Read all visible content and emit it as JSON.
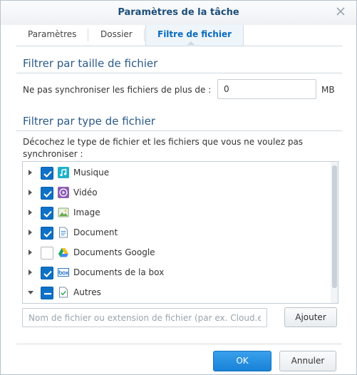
{
  "dialog": {
    "title": "Paramètres de la tâche"
  },
  "tabs": [
    {
      "label": "Paramètres"
    },
    {
      "label": "Dossier"
    },
    {
      "label": "Filtre de fichier",
      "active": true
    }
  ],
  "size_filter": {
    "title": "Filtrer par taille de fichier",
    "label": "Ne pas synchroniser les fichiers de plus de :",
    "value": "0",
    "unit": "MB"
  },
  "type_filter": {
    "title": "Filtrer par type de fichier",
    "description_line1": "Décochez le type de fichier et les fichiers que vous ne voulez pas",
    "description_line2": "synchroniser :",
    "items": [
      {
        "label": "Musique",
        "state": "checked",
        "expanded": false,
        "icon": "music-icon"
      },
      {
        "label": "Vidéo",
        "state": "checked",
        "expanded": false,
        "icon": "video-icon"
      },
      {
        "label": "Image",
        "state": "checked",
        "expanded": false,
        "icon": "image-icon"
      },
      {
        "label": "Document",
        "state": "checked",
        "expanded": false,
        "icon": "document-icon"
      },
      {
        "label": "Documents Google",
        "state": "unchecked",
        "expanded": false,
        "icon": "google-drive-icon"
      },
      {
        "label": "Documents de la box",
        "state": "checked",
        "expanded": false,
        "icon": "box-icon"
      },
      {
        "label": "Autres",
        "state": "partial",
        "expanded": true,
        "icon": "other-files-icon"
      }
    ]
  },
  "add_filter": {
    "placeholder": "Nom de fichier ou extension de fichier (par ex. Cloud.e",
    "button_label": "Ajouter"
  },
  "footer": {
    "ok_label": "OK",
    "cancel_label": "Annuler"
  },
  "colors": {
    "accent": "#0e71c8",
    "title": "#1e4f7b",
    "section": "#2a5a8a"
  }
}
